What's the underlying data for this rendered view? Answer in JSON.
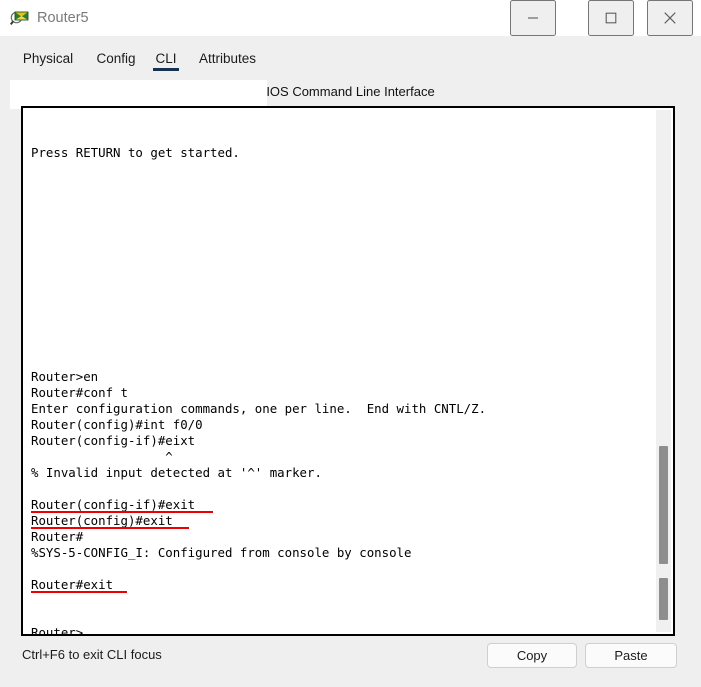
{
  "window": {
    "title": "Router5",
    "icon": "router-device-icon",
    "controls": {
      "minimize": "minimize-icon",
      "maximize": "maximize-icon",
      "close": "close-icon"
    }
  },
  "tabs": [
    {
      "label": "Physical",
      "active": false
    },
    {
      "label": "Config",
      "active": false
    },
    {
      "label": "CLI",
      "active": true
    },
    {
      "label": "Attributes",
      "active": false
    }
  ],
  "panel": {
    "header": "IOS Command Line Interface"
  },
  "terminal": {
    "lines": [
      {
        "text": "",
        "underline": 0
      },
      {
        "text": "",
        "underline": 0
      },
      {
        "text": "Press RETURN to get started.",
        "underline": 0
      },
      {
        "text": "",
        "underline": 0
      },
      {
        "text": "",
        "underline": 0
      },
      {
        "text": "",
        "underline": 0
      },
      {
        "text": "",
        "underline": 0
      },
      {
        "text": "",
        "underline": 0
      },
      {
        "text": "",
        "underline": 0
      },
      {
        "text": "",
        "underline": 0
      },
      {
        "text": "",
        "underline": 0
      },
      {
        "text": "",
        "underline": 0
      },
      {
        "text": "",
        "underline": 0
      },
      {
        "text": "",
        "underline": 0
      },
      {
        "text": "",
        "underline": 0
      },
      {
        "text": "",
        "underline": 0
      },
      {
        "text": "Router>en",
        "underline": 0
      },
      {
        "text": "Router#conf t",
        "underline": 0
      },
      {
        "text": "Enter configuration commands, one per line.  End with CNTL/Z.",
        "underline": 0
      },
      {
        "text": "Router(config)#int f0/0",
        "underline": 0
      },
      {
        "text": "Router(config-if)#eixt",
        "underline": 0
      },
      {
        "text": "                  ^",
        "underline": 0
      },
      {
        "text": "% Invalid input detected at '^' marker.",
        "underline": 0
      },
      {
        "text": "",
        "underline": 0
      },
      {
        "text": "Router(config-if)#exit",
        "underline": 182
      },
      {
        "text": "Router(config)#exit",
        "underline": 158
      },
      {
        "text": "Router#",
        "underline": 0
      },
      {
        "text": "%SYS-5-CONFIG_I: Configured from console by console",
        "underline": 0
      },
      {
        "text": "",
        "underline": 0
      },
      {
        "text": "Router#exit",
        "underline": 96
      },
      {
        "text": "",
        "underline": 0
      },
      {
        "text": "",
        "underline": 0
      },
      {
        "text": "Router>",
        "underline": 65
      }
    ],
    "scrollbar": {
      "thumb_main": "scrollbar-thumb",
      "thumb_sub": "scrollbar-thumb-secondary"
    }
  },
  "footer": {
    "hint": "Ctrl+F6 to exit CLI focus",
    "copy_label": "Copy",
    "paste_label": "Paste"
  },
  "colors": {
    "accent": "#16314f",
    "highlight": "#ee0000",
    "window_bg": "#efefef",
    "terminal_bg": "#ffffff",
    "title_text": "#7a7a7a"
  }
}
